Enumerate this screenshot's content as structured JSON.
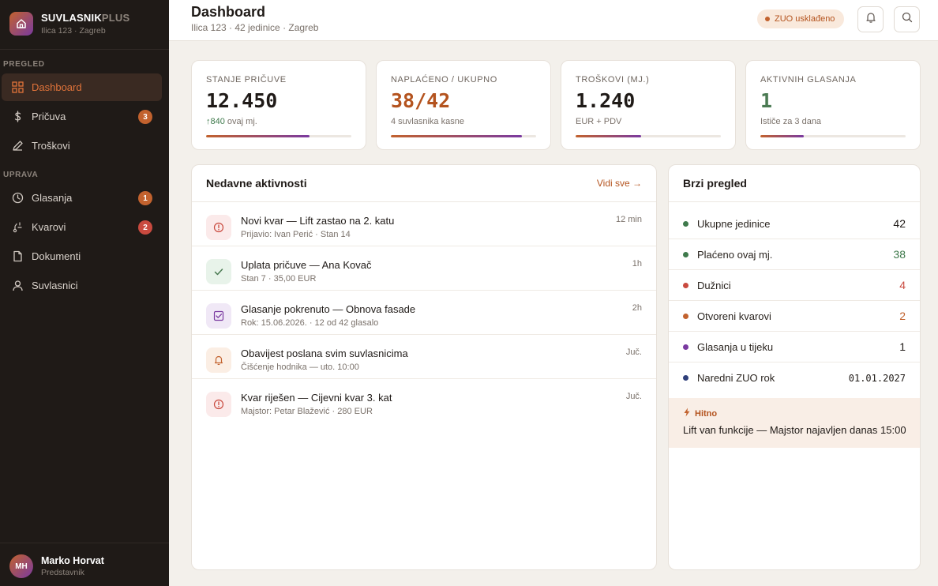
{
  "brand": {
    "name_main": "SUVLASNIK",
    "name_accent": "PLUS",
    "subtitle": "Ilica 123 · Zagreb"
  },
  "sidebar": {
    "sections": [
      {
        "label": "PREGLED"
      },
      {
        "label": "UPRAVA"
      }
    ],
    "items": [
      {
        "label": "Dashboard",
        "icon": "grid-icon",
        "active": true
      },
      {
        "label": "Pričuva",
        "icon": "dollar-icon",
        "badge": "3",
        "badge_color": "#c2622e"
      },
      {
        "label": "Troškovi",
        "icon": "pencil-icon"
      },
      {
        "label": "Glasanja",
        "icon": "clock-icon",
        "badge": "1",
        "badge_color": "#c2622e"
      },
      {
        "label": "Kvarovi",
        "icon": "wrench-icon",
        "badge": "2",
        "badge_color": "#c94a3f"
      },
      {
        "label": "Dokumenti",
        "icon": "document-icon"
      },
      {
        "label": "Suvlasnici",
        "icon": "user-icon"
      }
    ]
  },
  "user": {
    "initials": "MH",
    "name": "Marko Horvat",
    "role": "Predstavnik"
  },
  "header": {
    "title": "Dashboard",
    "subtitle": "Ilica 123 · 42 jedinice · Zagreb",
    "status_badge": "ZUO usklađeno"
  },
  "stats": [
    {
      "label": "STANJE PRIČUVE",
      "value": "12.450",
      "value_color": "#1f1a17",
      "trend_arrow": "↑",
      "sub": "840",
      "sub_suffix": "ovaj mj.",
      "progress": 0.71
    },
    {
      "label": "NAPLAĆENO / UKUPNO",
      "value": "38/42",
      "value_color": "#b4531e",
      "sub": "4 suvlasnika kasne",
      "progress": 0.9
    },
    {
      "label": "TROŠKOVI (MJ.)",
      "value": "1.240",
      "value_color": "#1f1a17",
      "sub": "EUR + PDV",
      "progress": 0.45
    },
    {
      "label": "AKTIVNIH GLASANJA",
      "value": "1",
      "value_color": "#4a7a52",
      "sub": "Ističe za 3 dana",
      "progress": 0.3
    }
  ],
  "activity": {
    "title": "Nedavne aktivnosti",
    "see_all": "Vidi sve →",
    "items": [
      {
        "icon": "alert-icon",
        "icon_color": "#c94a3f",
        "icon_bg": "#fbeaea",
        "title": "Novi kvar — Lift zastao na 2. katu",
        "sub": "Prijavio: Ivan Perić · Stan 14",
        "time": "12 min"
      },
      {
        "icon": "check-icon",
        "icon_color": "#4a7a52",
        "icon_bg": "#e8f3ea",
        "title": "Uplata pričuve — Ana Kovač",
        "sub": "Stan 7 · 35,00 EUR",
        "time": "1h"
      },
      {
        "icon": "checkbox-icon",
        "icon_color": "#7a3aa0",
        "icon_bg": "#f0e8f6",
        "title": "Glasanje pokrenuto — Obnova fasade",
        "sub": "Rok: 15.06.2026. · 12 od 42 glasalo",
        "time": "2h"
      },
      {
        "icon": "bell-icon",
        "icon_color": "#c2622e",
        "icon_bg": "#fbeee4",
        "title": "Obavijest poslana svim suvlasnicima",
        "sub": "Čišćenje hodnika — uto. 10:00",
        "time": "Juč."
      },
      {
        "icon": "alert-icon",
        "icon_color": "#c94a3f",
        "icon_bg": "#fbeaea",
        "title": "Kvar riješen — Cijevni kvar 3. kat",
        "sub": "Majstor: Petar Blažević · 280 EUR",
        "time": "Juč."
      }
    ]
  },
  "quick": {
    "title": "Brzi pregled",
    "rows": [
      {
        "label": "Ukupne jedinice",
        "value": "42",
        "dot": "#3f7a4c",
        "value_color": "#1f1a17"
      },
      {
        "label": "Plaćeno ovaj mj.",
        "value": "38",
        "dot": "#3f7a4c",
        "value_color": "#3f7a4c"
      },
      {
        "label": "Dužnici",
        "value": "4",
        "dot": "#c94a3f",
        "value_color": "#c94a3f"
      },
      {
        "label": "Otvoreni kvarovi",
        "value": "2",
        "dot": "#c2622e",
        "value_color": "#c2622e"
      },
      {
        "label": "Glasanja u tijeku",
        "value": "1",
        "dot": "#7a3aa0",
        "value_color": "#1f1a17"
      },
      {
        "label": "Naredni ZUO rok",
        "value": "01.01.2027",
        "dot": "#2f3f7a",
        "value_color": "#1f1a17",
        "mono": true
      }
    ],
    "urgent_label": "Hitno",
    "urgent_text": "Lift van funkcije — Majstor najavljen danas 15:00"
  },
  "colors": {
    "accent": "#c2622e",
    "purple": "#7a3aa0",
    "sidebar_bg": "#1f1a17",
    "page_bg": "#f3f0eb"
  }
}
